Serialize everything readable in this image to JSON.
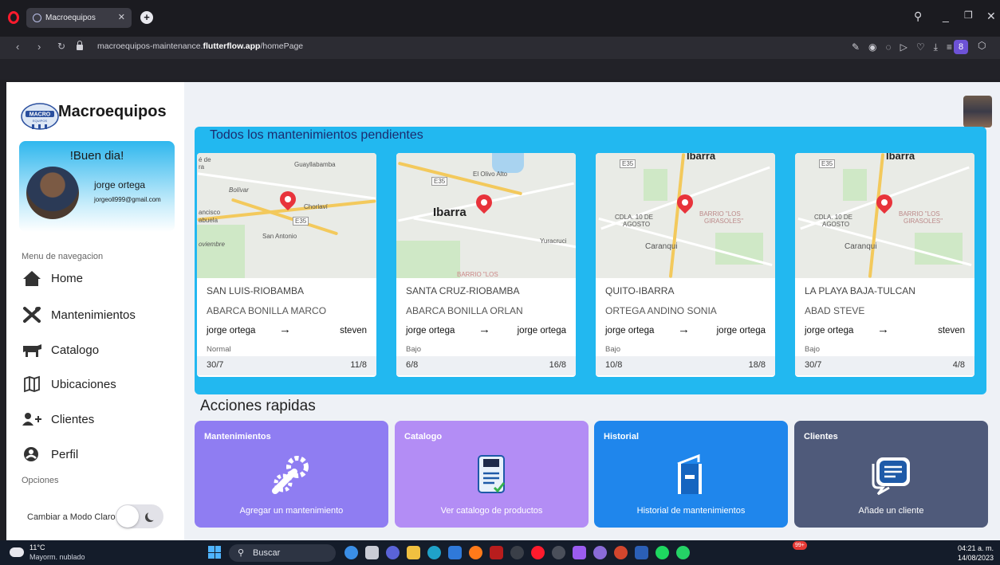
{
  "browser": {
    "tab_title": "Macroequipos",
    "url_prefix": "macroequipos-maintenance.",
    "url_domain": "flutterflow.app",
    "url_path": "/homePage",
    "profile_initial": "8"
  },
  "sidebar": {
    "brand": "Macroequipos",
    "logo_text": "MACRO",
    "logo_subtext": "EQUIPOS",
    "greeting": "!Buen dia!",
    "user_name": "jorge ortega",
    "user_email": "jorgeoll999@gmail.com",
    "menu_title": "Menu de navegacion",
    "items": [
      {
        "label": "Home",
        "icon": "home-icon"
      },
      {
        "label": "Mantenimientos",
        "icon": "tools-icon"
      },
      {
        "label": "Catalogo",
        "icon": "cow-icon"
      },
      {
        "label": "Ubicaciones",
        "icon": "map-icon"
      },
      {
        "label": "Clientes",
        "icon": "add-user-icon"
      },
      {
        "label": "Perfil",
        "icon": "profile-icon"
      }
    ],
    "options_title": "Opciones",
    "mode_label": "Cambiar a Modo Claro"
  },
  "pending": {
    "title": "Todos los mantenimientos pendientes",
    "cards": [
      {
        "location": "SAN LUIS-RIOBAMBA",
        "client": "ABARCA BONILLA MARCO",
        "from": "jorge ortega",
        "to": "steven",
        "priority": "Normal",
        "start": "30/7",
        "end": "11/8",
        "map_labels": [
          "é de",
          "ra",
          "Guayllabamba",
          "Bolívar",
          "Chorlaví",
          "ancisco",
          "abuela",
          "E35",
          "San Antonio",
          "oviembre"
        ]
      },
      {
        "location": "SANTA CRUZ-RIOBAMBA",
        "client": "ABARCA BONILLA ORLAN",
        "from": "jorge ortega",
        "to": "jorge ortega",
        "priority": "Bajo",
        "start": "6/8",
        "end": "16/8",
        "map_labels": [
          "El Olivo Alto",
          "E35",
          "Ibarra",
          "Yuracruci",
          "BARRIO \"LOS"
        ]
      },
      {
        "location": "QUITO-IBARRA",
        "client": "ORTEGA ANDINO SONIA",
        "from": "jorge ortega",
        "to": "jorge ortega",
        "priority": "Bajo",
        "start": "10/8",
        "end": "18/8",
        "map_labels": [
          "E35",
          "Ibarra",
          "CDLA. 10 DE",
          "AGOSTO",
          "BARRIO \"LOS",
          "GIRASOLES\"",
          "Caranqui"
        ]
      },
      {
        "location": "LA PLAYA BAJA-TULCAN",
        "client": "ABAD STEVE",
        "from": "jorge ortega",
        "to": "steven",
        "priority": "Bajo",
        "start": "30/7",
        "end": "4/8",
        "map_labels": [
          "E35",
          "Ibarra",
          "CDLA. 10 DE",
          "AGOSTO",
          "BARRIO \"LOS",
          "GIRASOLES\"",
          "Caranqui"
        ]
      }
    ]
  },
  "quick": {
    "title": "Acciones rapidas",
    "cards": [
      {
        "title": "Mantenimientos",
        "label": "Agregar un mantenimiento",
        "color": "#8f7df2",
        "icon": "wrench-gear-icon"
      },
      {
        "title": "Catalogo",
        "label": "Ver catalogo de productos",
        "color": "#b38df5",
        "icon": "catalog-clipboard-icon"
      },
      {
        "title": "Historial",
        "label": "Historial de mantenimientos",
        "color": "#1f86ec",
        "icon": "book-icon"
      },
      {
        "title": "Clientes",
        "label": "Añade un cliente",
        "color": "#4f5a7a",
        "icon": "chat-message-icon"
      }
    ]
  },
  "taskbar": {
    "temperature": "11°C",
    "weather": "Mayorm. nublado",
    "search": "Buscar",
    "notification_badge": "99+",
    "time": "04:21 a. m.",
    "date": "14/08/2023"
  },
  "colors": {
    "pending_bg": "#22b8f0",
    "pending_title": "#1b2c6f",
    "map_pin": "#e8333b"
  }
}
